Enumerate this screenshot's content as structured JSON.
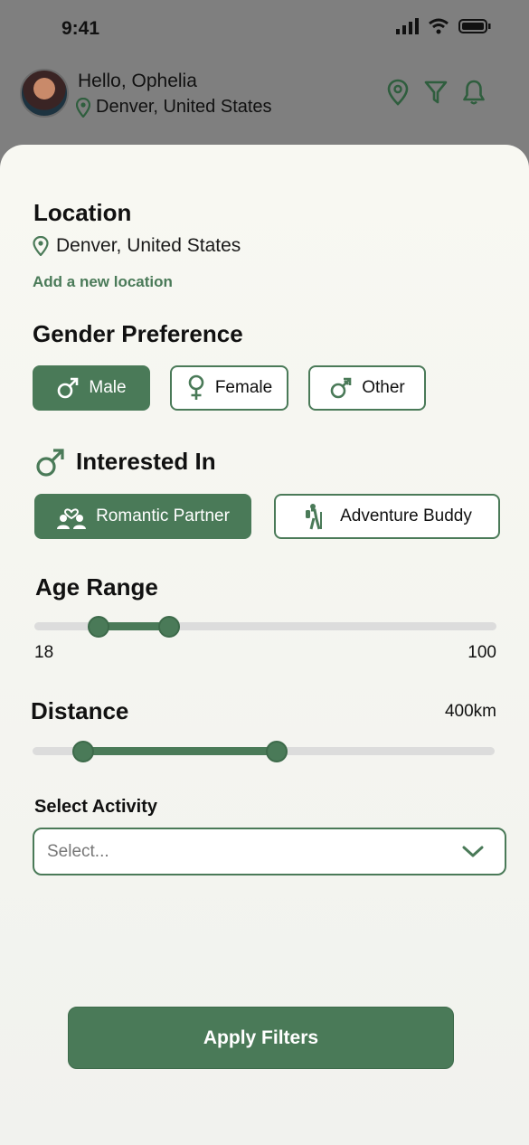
{
  "status": {
    "time": "9:41"
  },
  "header": {
    "greeting": "Hello, Ophelia",
    "location": "Denver, United States"
  },
  "filters": {
    "location": {
      "title": "Location",
      "value": "Denver, United States",
      "add_link": "Add a new location"
    },
    "gender": {
      "title": "Gender Preference",
      "options": [
        "Male",
        "Female",
        "Other"
      ],
      "selected": "Male"
    },
    "interest": {
      "title": "Interested In",
      "options": [
        "Romantic Partner",
        "Adventure Buddy"
      ],
      "selected": "Romantic Partner"
    },
    "age": {
      "title": "Age Range",
      "min_label": "18",
      "max_label": "100",
      "range_min": 18,
      "range_max": 100,
      "value_low": 28,
      "value_high": 41
    },
    "distance": {
      "title": "Distance",
      "value_label": "400km",
      "value_low_fraction": 0.09,
      "value_high_fraction": 0.53
    },
    "activity": {
      "title": "Select Activity",
      "placeholder": "Select..."
    },
    "apply_label": "Apply Filters"
  },
  "colors": {
    "accent": "#4a7a58",
    "track": "#dcdcdc",
    "overlay": "#7f7f7f"
  }
}
